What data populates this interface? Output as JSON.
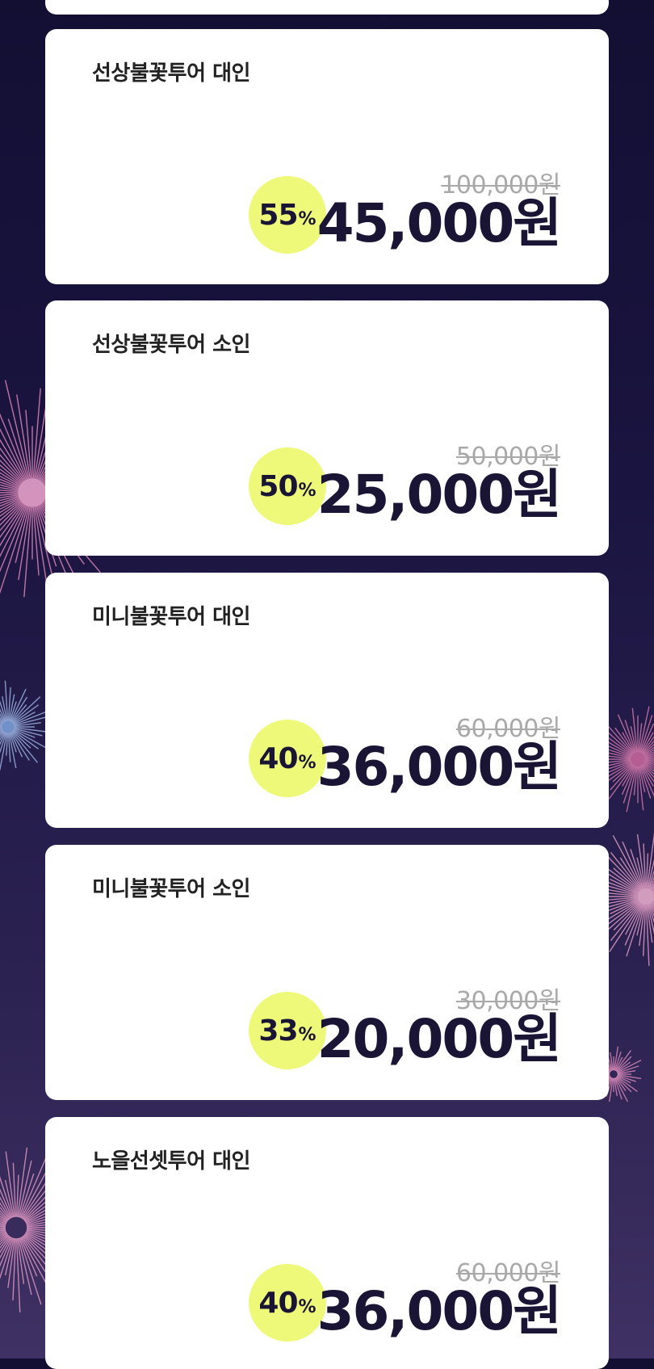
{
  "colors": {
    "background_top": "#130f33",
    "background_bottom": "#3f3163",
    "card": "#ffffff",
    "badge": "#eef97a",
    "price_text": "#1a1535",
    "original_price_text": "#a9a9a9"
  },
  "products": [
    {
      "name": "선상불꽃투어 대인",
      "discount": "55",
      "percent_symbol": "%",
      "original_price": "100,000원",
      "sale_price": "45,000원"
    },
    {
      "name": "선상불꽃투어 소인",
      "discount": "50",
      "percent_symbol": "%",
      "original_price": "50,000원",
      "sale_price": "25,000원"
    },
    {
      "name": "미니불꽃투어 대인",
      "discount": "40",
      "percent_symbol": "%",
      "original_price": "60,000원",
      "sale_price": "36,000원"
    },
    {
      "name": "미니불꽃투어 소인",
      "discount": "33",
      "percent_symbol": "%",
      "original_price": "30,000원",
      "sale_price": "20,000원"
    },
    {
      "name": "노을선셋투어 대인",
      "discount": "40",
      "percent_symbol": "%",
      "original_price": "60,000원",
      "sale_price": "36,000원"
    }
  ]
}
